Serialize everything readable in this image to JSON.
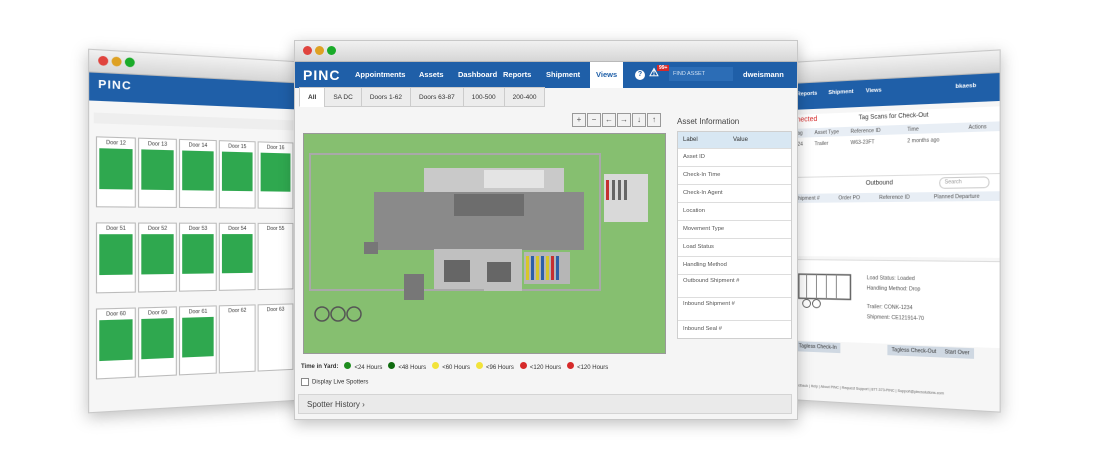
{
  "main": {
    "logo": "PINC",
    "nav": {
      "appointments": "Appointments",
      "assets": "Assets",
      "dashboard": "Dashboard",
      "reports": "Reports",
      "shipment": "Shipment",
      "views": "Views",
      "badge": "99+",
      "search_placeholder": "FIND ASSET",
      "user": "dweismann"
    },
    "tabs": [
      "All",
      "SA DC",
      "Doors 1-62",
      "Doors 63-87",
      "100-500",
      "200-400"
    ],
    "panel": {
      "title": "Asset Information",
      "header_label": "Label",
      "header_value": "Value",
      "rows": [
        "Asset ID",
        "Check-In Time",
        "Check-In Agent",
        "Location",
        "Movement Type",
        "Load Status",
        "Handling Method",
        "Outbound Shipment #",
        "Inbound Shipment #",
        "Inbound Seal #"
      ]
    },
    "legend": {
      "label": "Time in Yard:",
      "items": [
        {
          "text": "<24 Hours",
          "color": "#1e8c1e"
        },
        {
          "text": "<48 Hours",
          "color": "#0f6b0f"
        },
        {
          "text": "<60 Hours",
          "color": "#f2e33a"
        },
        {
          "text": "<96 Hours",
          "color": "#f2e33a"
        },
        {
          "text": "<120 Hours",
          "color": "#d62a2a"
        },
        {
          "text": "<120 Hours",
          "color": "#d62a2a"
        }
      ]
    },
    "display_live_spotters": "Display Live Spotters",
    "spotter_history": "Spotter History ›"
  },
  "left": {
    "logo": "PINC",
    "doors_row1": [
      "Door 12",
      "Door 13",
      "Door 14",
      "Door 15",
      "Door 16"
    ],
    "doors_row2": [
      "Door 51",
      "Door 52",
      "Door 53",
      "Door 54",
      "Door 55"
    ],
    "doors_row3": [
      "Door 60",
      "Door 60",
      "Door 61",
      "Door 62",
      "Door 63"
    ]
  },
  "right": {
    "nav": {
      "reports": "Reports",
      "shipment": "Shipment",
      "views": "Views",
      "user": "bkaesb"
    },
    "connected": "nnected",
    "tag_scans": "Tag Scans for Check-Out",
    "cols": [
      "Tag",
      "Asset Type",
      "Reference ID",
      "Time",
      "Actions"
    ],
    "row": [
      "824",
      "Trailer",
      "W63-23FT",
      "2 months ago"
    ],
    "outbound": "Outbound",
    "search": "Search",
    "out_cols": [
      "Shipment #",
      "Order PO",
      "Reference ID",
      "Planned Departure"
    ],
    "load_status": "Load Status: Loaded",
    "handling": "Handling Method: Drop",
    "trailer": "Trailer: CONK-1234",
    "shipment": "Shipment: CE121914-70",
    "buttons": [
      "Tagless Check-In",
      "Tagless Check-Out",
      "Start Over"
    ],
    "footer": "Feedback | Help | About PINC | Request Support | 877-373-PINC | Support@pincsolutions.com"
  },
  "colors": {
    "nav_blue": "#1f5fa8",
    "yard_green": "#86bf70",
    "door_green": "#2fa84f"
  }
}
